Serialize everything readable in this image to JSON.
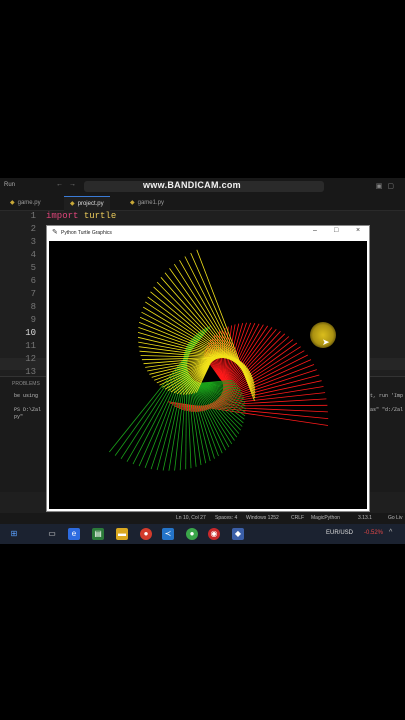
{
  "watermark": "www.BANDICAM.com",
  "ide": {
    "menu_run": "Run",
    "tabs": [
      {
        "label": "game.py"
      },
      {
        "label": "project.py"
      },
      {
        "label": "game1.py"
      }
    ],
    "line_numbers": [
      "1",
      "2",
      "3",
      "4",
      "5",
      "6",
      "7",
      "8",
      "9",
      "10",
      "11",
      "12",
      "13"
    ],
    "code_line1": {
      "keyword": "import",
      "module": "turtle"
    },
    "panel_title": "PROBLEMS",
    "terminal": {
      "left1": "be using",
      "left2": "PS D:\\Zal",
      "left3": "py\"",
      "right1": "t, run 'Imp",
      "right2": "as\" \"d:/Zal"
    }
  },
  "status_bar": {
    "position": "Ln 10, Col 27",
    "spaces": "Spaces: 4",
    "encoding": "Windows 1252",
    "eol": "CRLF",
    "language": "MagicPython",
    "version": "3.13.1",
    "live": "Go Liv"
  },
  "turtle_window": {
    "title": "Python Turtle Graphics",
    "minimize": "–",
    "maximize": "□",
    "close": "×"
  },
  "taskbar": {
    "currency_pair": "EUR/USD",
    "currency_change": "-0.52%"
  },
  "colors": {
    "spiral_red": "#ff1a1a",
    "spiral_green": "#1aa01a",
    "spiral_yellow": "#f2e21a",
    "accent": "#3b7bd6"
  }
}
